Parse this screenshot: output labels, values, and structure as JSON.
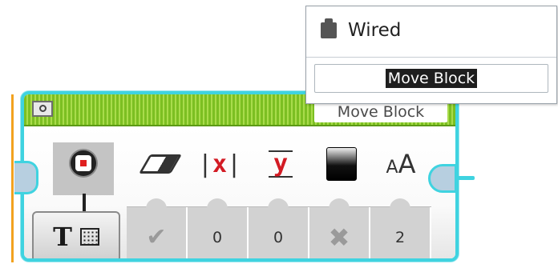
{
  "block": {
    "title": "Move Block",
    "mode_icon": "display-shape-icon",
    "text_mode_icon": "text-grid-icon",
    "text_mode_letter": "T",
    "params": [
      {
        "icon": "eraser-icon",
        "value_type": "checkmark",
        "value": "✔"
      },
      {
        "icon": "x-coordinate-icon",
        "symbol": "x",
        "value": "0"
      },
      {
        "icon": "y-coordinate-icon",
        "symbol": "y",
        "value": "0"
      },
      {
        "icon": "fill-color-icon",
        "value_type": "cross",
        "value": "✖"
      },
      {
        "icon": "font-size-icon",
        "symbol_small": "A",
        "symbol_large": "A",
        "value": "2"
      }
    ]
  },
  "popup": {
    "wired_label": "Wired",
    "wired_icon": "brick-icon",
    "field_value": "Move Block"
  },
  "colors": {
    "block_border": "#3fd3e0",
    "title_bar": "#8cc63f",
    "accent_red": "#d31b24",
    "edge_orange": "#f2a21f"
  }
}
